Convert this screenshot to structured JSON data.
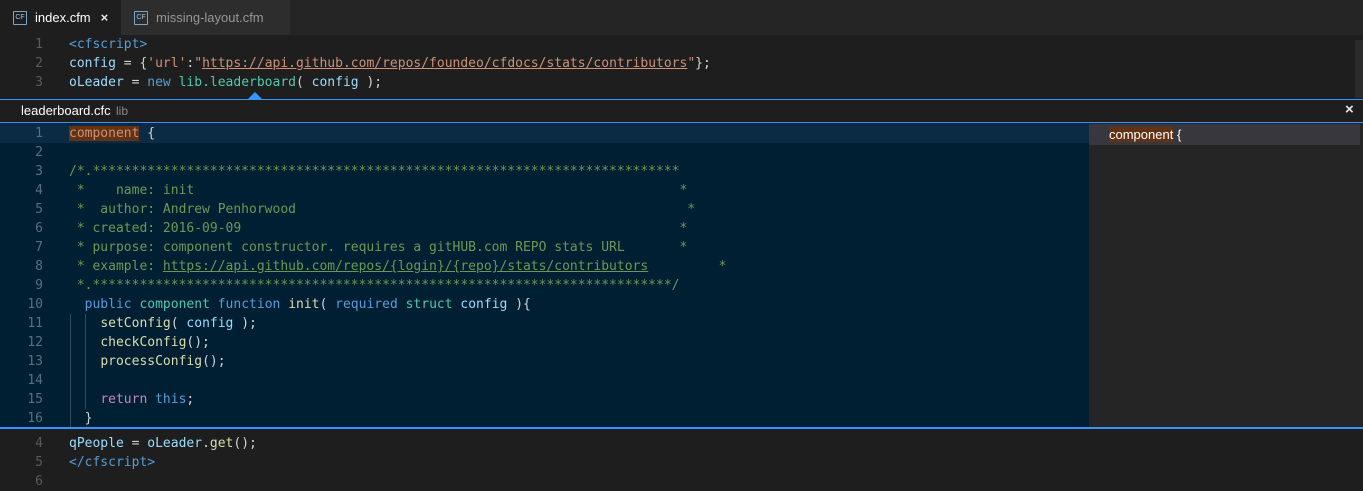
{
  "tabs": [
    {
      "label": "index.cfm",
      "icon": "CF",
      "active": true
    },
    {
      "label": "missing-layout.cfm",
      "icon": "CF",
      "active": false
    }
  ],
  "editor_top": [
    {
      "n": "1",
      "tokens": [
        [
          "tg",
          "<cfscript>"
        ]
      ]
    },
    {
      "n": "2",
      "tokens": [
        [
          "tn",
          "config"
        ],
        [
          "plain",
          " = {"
        ],
        [
          "st",
          "'url'"
        ],
        [
          "plain",
          ":"
        ],
        [
          "st",
          "\""
        ],
        [
          "stl",
          "https://api.github.com/repos/foundeo/cfdocs/stats/contributors"
        ],
        [
          "st",
          "\""
        ],
        [
          "plain",
          "};"
        ]
      ]
    },
    {
      "n": "3",
      "tokens": [
        [
          "tn",
          "oLeader"
        ],
        [
          "plain",
          " = "
        ],
        [
          "kw",
          "new "
        ],
        [
          "ty",
          "lib.leaderboard"
        ],
        [
          "plain",
          "( "
        ],
        [
          "tn",
          "config"
        ],
        [
          "plain",
          " );"
        ]
      ]
    }
  ],
  "peek": {
    "file": "leaderboard.cfc",
    "folder": "lib",
    "reference": {
      "match": "component",
      "rest": " {"
    },
    "lines": [
      {
        "n": "1",
        "tokens": [
          [
            "match",
            "component"
          ],
          [
            "plain",
            " {"
          ]
        ]
      },
      {
        "n": "2",
        "tokens": []
      },
      {
        "n": "3",
        "tokens": [
          [
            "cm",
            "/*.***************************************************************************"
          ]
        ]
      },
      {
        "n": "4",
        "tokens": [
          [
            "cm",
            " *    name: init                                                              *"
          ]
        ]
      },
      {
        "n": "5",
        "tokens": [
          [
            "cm",
            " *  author: Andrew Penhorwood                                                  *"
          ]
        ]
      },
      {
        "n": "6",
        "tokens": [
          [
            "cm",
            " * created: 2016-09-09                                                        *"
          ]
        ]
      },
      {
        "n": "7",
        "tokens": [
          [
            "cm",
            " * purpose: component constructor. requires a gitHUB.com REPO stats URL       *"
          ]
        ]
      },
      {
        "n": "8",
        "tokens": [
          [
            "cm",
            " * example: "
          ],
          [
            "cml",
            "https://api.github.com/repos/{login}/{repo}/stats/contributors"
          ],
          [
            "cm",
            "         *"
          ]
        ]
      },
      {
        "n": "9",
        "tokens": [
          [
            "cm",
            " *.**************************************************************************/"
          ]
        ]
      },
      {
        "n": "10",
        "tokens": [
          [
            "plain",
            "  "
          ],
          [
            "kw",
            "public "
          ],
          [
            "ty",
            "component "
          ],
          [
            "kw",
            "function "
          ],
          [
            "fn",
            "init"
          ],
          [
            "plain",
            "( "
          ],
          [
            "kw",
            "required "
          ],
          [
            "ty",
            "struct "
          ],
          [
            "tn",
            "config"
          ],
          [
            "plain",
            " ){"
          ]
        ]
      },
      {
        "n": "11",
        "tokens": [
          [
            "plain",
            "    "
          ],
          [
            "fn",
            "setConfig"
          ],
          [
            "plain",
            "( "
          ],
          [
            "tn",
            "config"
          ],
          [
            "plain",
            " );"
          ]
        ]
      },
      {
        "n": "12",
        "tokens": [
          [
            "plain",
            "    "
          ],
          [
            "fn",
            "checkConfig"
          ],
          [
            "plain",
            "();"
          ]
        ]
      },
      {
        "n": "13",
        "tokens": [
          [
            "plain",
            "    "
          ],
          [
            "fn",
            "processConfig"
          ],
          [
            "plain",
            "();"
          ]
        ]
      },
      {
        "n": "14",
        "tokens": []
      },
      {
        "n": "15",
        "tokens": [
          [
            "plain",
            "    "
          ],
          [
            "ct",
            "return "
          ],
          [
            "kw",
            "this"
          ],
          [
            "plain",
            ";"
          ]
        ]
      },
      {
        "n": "16",
        "tokens": [
          [
            "plain",
            "  }"
          ]
        ]
      }
    ]
  },
  "editor_bottom": [
    {
      "n": "4",
      "tokens": [
        [
          "tn",
          "qPeople"
        ],
        [
          "plain",
          " = "
        ],
        [
          "tn",
          "oLeader"
        ],
        [
          "plain",
          "."
        ],
        [
          "fn",
          "get"
        ],
        [
          "plain",
          "();"
        ]
      ]
    },
    {
      "n": "5",
      "tokens": [
        [
          "tg",
          "</cfscript>"
        ]
      ]
    },
    {
      "n": "6",
      "tokens": []
    }
  ],
  "icons": {
    "close_tab": "×",
    "close_peek": "×"
  },
  "colors": {
    "accent": "#3794ff",
    "peek_background": "#001f33",
    "match_highlight": "#613214"
  }
}
